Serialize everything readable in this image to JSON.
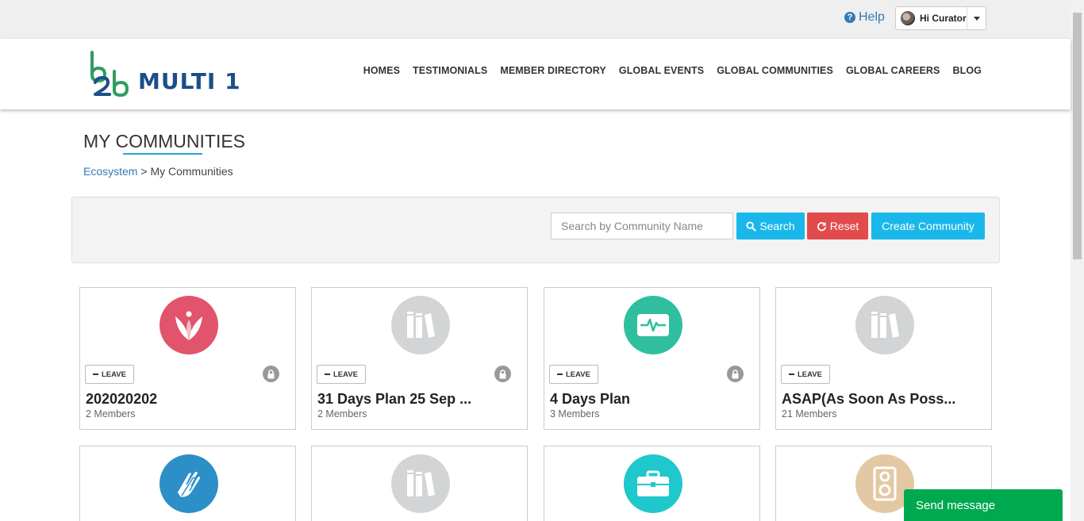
{
  "topbar": {
    "help_label": "Help",
    "help_icon": "question-circle-icon",
    "user_greeting": "Hi Curator"
  },
  "logo": {
    "mark": "b2b",
    "text": "MULTI 1",
    "colors": {
      "green": "#2e9d5f",
      "blue": "#1b4f8a"
    }
  },
  "nav": {
    "items": [
      "HOMES",
      "TESTIMONIALS",
      "MEMBER DIRECTORY",
      "GLOBAL EVENTS",
      "GLOBAL COMMUNITIES",
      "GLOBAL CAREERS",
      "BLOG"
    ]
  },
  "page": {
    "title": "MY COMMUNITIES",
    "breadcrumb_root": "Ecosystem",
    "breadcrumb_sep": ">",
    "breadcrumb_current": "My Communities"
  },
  "search": {
    "placeholder": "Search by Community Name",
    "search_label": "Search",
    "reset_label": "Reset",
    "create_label": "Create Community"
  },
  "communities": [
    {
      "name": "202020202",
      "members": "2 Members",
      "leave_label": "LEAVE",
      "private": true,
      "icon": "lotus-icon",
      "color": "#e2546b"
    },
    {
      "name": "31 Days Plan 25 Sep ...",
      "members": "2 Members",
      "leave_label": "LEAVE",
      "private": true,
      "icon": "books-icon",
      "color": "#d2d4d6"
    },
    {
      "name": "4 Days Plan",
      "members": "3 Members",
      "leave_label": "LEAVE",
      "private": true,
      "icon": "heartbeat-monitor-icon",
      "color": "#2fbf9f"
    },
    {
      "name": "ASAP(As Soon As Poss...",
      "members": "21 Members",
      "leave_label": "LEAVE",
      "private": false,
      "icon": "books-icon",
      "color": "#d2d4d6"
    },
    {
      "icon": "praying-hands-icon",
      "color": "#2d8fc7"
    },
    {
      "icon": "books-icon",
      "color": "#d2d4d6"
    },
    {
      "icon": "briefcase-icon",
      "color": "#1ec8cc"
    },
    {
      "icon": "speaker-icon",
      "color": "#e3c9a3"
    }
  ],
  "chat": {
    "label": "Send message",
    "color": "#00a84f"
  }
}
